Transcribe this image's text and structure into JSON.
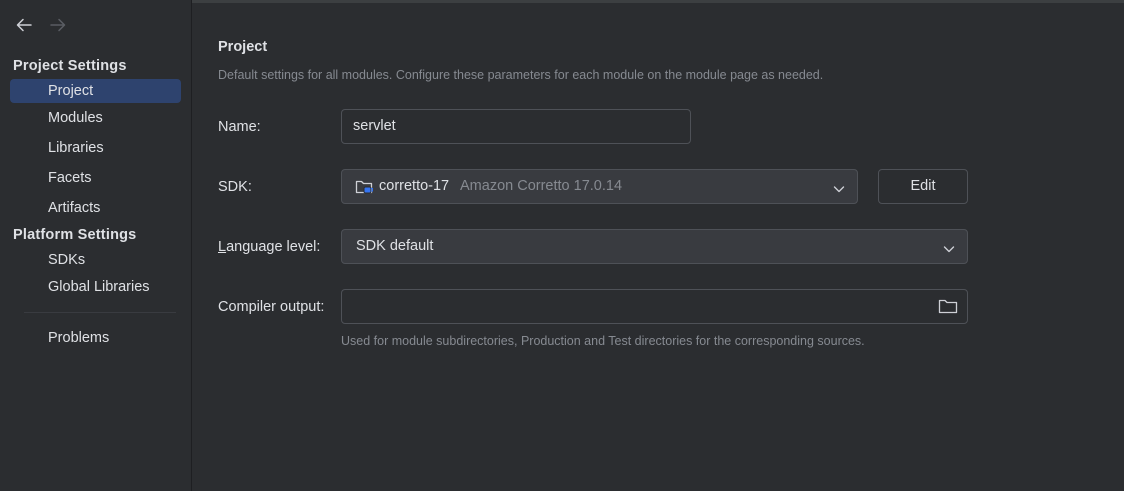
{
  "nav": {
    "back_icon": "arrow-left-icon",
    "forward_icon": "arrow-right-icon"
  },
  "sidebar": {
    "project_settings_header": "Project Settings",
    "project_items": [
      "Project",
      "Modules",
      "Libraries",
      "Facets",
      "Artifacts"
    ],
    "platform_settings_header": "Platform Settings",
    "platform_items": [
      "SDKs",
      "Global Libraries"
    ],
    "other_items": [
      "Problems"
    ],
    "selected": "Project"
  },
  "main": {
    "title": "Project",
    "subtitle": "Default settings for all modules. Configure these parameters for each module on the module page as needed.",
    "name": {
      "label": "Name:",
      "value": "servlet"
    },
    "sdk": {
      "label": "SDK:",
      "name": "corretto-17",
      "description": "Amazon Corretto 17.0.14",
      "icon": "sdk-folder-icon",
      "edit_label": "Edit"
    },
    "language_level": {
      "label_prefix": "L",
      "label_rest": "anguage level:",
      "value": "SDK default"
    },
    "compiler_output": {
      "label": "Compiler output:",
      "value": "",
      "browse_icon": "folder-icon",
      "hint": "Used for module subdirectories, Production and Test directories for the corresponding sources."
    }
  },
  "colors": {
    "background": "#2b2d30",
    "selection": "#2e436e",
    "muted_text": "#868a91",
    "border": "#4e5157"
  }
}
